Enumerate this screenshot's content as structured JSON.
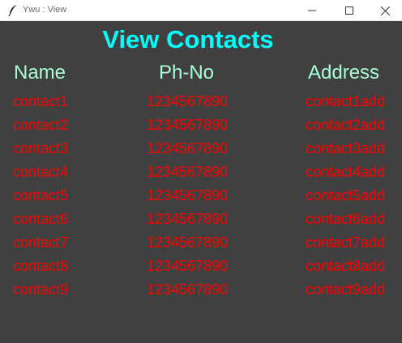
{
  "window": {
    "title": "Ywu : View",
    "icon": "feather-icon"
  },
  "heading": "View Contacts",
  "columns": {
    "name": "Name",
    "phone": "Ph-No",
    "address": "Address"
  },
  "contacts": [
    {
      "name": "contact1",
      "phone": "1234567890",
      "address": "contact1add"
    },
    {
      "name": "contact2",
      "phone": "1234567890",
      "address": "contact2add"
    },
    {
      "name": "contact3",
      "phone": "1234567890",
      "address": "contact3add"
    },
    {
      "name": "contact4",
      "phone": "1234567890",
      "address": "contact4add"
    },
    {
      "name": "contact5",
      "phone": "1234567890",
      "address": "contact5add"
    },
    {
      "name": "contact6",
      "phone": "1234567890",
      "address": "contact6add"
    },
    {
      "name": "contact7",
      "phone": "1234567890",
      "address": "contact7add"
    },
    {
      "name": "contact8",
      "phone": "1234567890",
      "address": "contact8add"
    },
    {
      "name": "contact9",
      "phone": "1234567890",
      "address": "contact9add"
    }
  ],
  "colors": {
    "background": "#404040",
    "heading": "#00ffff",
    "column_header": "#a8ffd8",
    "cell_text": "#ff0000"
  }
}
